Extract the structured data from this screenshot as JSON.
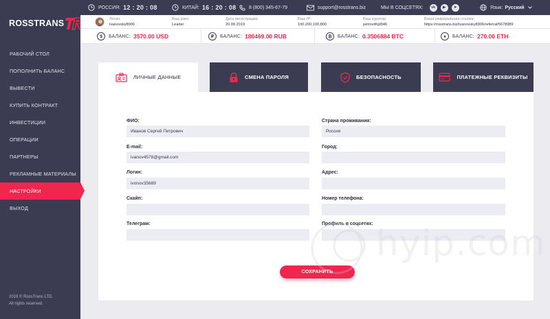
{
  "brand": {
    "logo_text": "ROSSTRANS"
  },
  "sidebar": {
    "items": [
      {
        "label": "РАБОЧИЙ СТОЛ"
      },
      {
        "label": "ПОПОЛНИТЬ БАЛАНС"
      },
      {
        "label": "ВЫВЕСТИ"
      },
      {
        "label": "КУПИТЬ КОНТРАКТ"
      },
      {
        "label": "ИНВЕСТИЦИИ"
      },
      {
        "label": "ОПЕРАЦИИ"
      },
      {
        "label": "ПАРТНЕРЫ"
      },
      {
        "label": "РЕКЛАМНЫЕ МАТЕРИАЛЫ"
      },
      {
        "label": "НАСТРОЙКИ",
        "active": true
      },
      {
        "label": "ВЫХОД"
      }
    ],
    "copyright_line1": "2019 © RossTrans LTD.",
    "copyright_line2": "All rights reserved."
  },
  "topbar": {
    "russia_label": "РОССИЯ:",
    "russia_time": "12 : 20 : 08",
    "china_label": "КИТАЙ:",
    "china_time": "16 : 20 : 08",
    "phone": "8 (800) 345-67-79",
    "email": "support@rosstrans.biz",
    "social_label": "МЫ В СОЦСЕТЯХ:",
    "language_label": "Язык:",
    "language_value": "Русский"
  },
  "userinfo": {
    "login_label": "Логин:",
    "login_value": "ivanovsky8906",
    "rank_label": "Ваш ранг:",
    "rank_value": "Leader",
    "reg_label": "Дата регистрации:",
    "reg_value": "20.09.2019",
    "ip_label": "Ваш IP:",
    "ip_value": "100.200.100.800",
    "curator_label": "Ваш куратор:",
    "curator_value": "petrovithjd346",
    "ref_label": "Ваша реферальная ссылка:",
    "ref_value": "https://rosstrans.biz/ivanovsky8906/referral/5678989"
  },
  "balances": [
    {
      "symbol": "$",
      "label": "БАЛАНС:",
      "value": "3570.00 USD"
    },
    {
      "symbol": "₽",
      "label": "БАЛАНС:",
      "value": "180469.00 RUB"
    },
    {
      "symbol": "₿",
      "label": "БАЛАНС:",
      "value": "0.3506884 BTC"
    },
    {
      "symbol": "♦",
      "label": "БАЛАНС:",
      "value": "270.00 ETH"
    }
  ],
  "tabs": [
    {
      "label": "ЛИЧНЫЕ ДАННЫЕ",
      "active": true
    },
    {
      "label": "СМЕНА ПАРОЛЯ"
    },
    {
      "label": "БЕЗОПАСНОСТЬ"
    },
    {
      "label": "ПЛАТЕЖНЫЕ РЕКВИЗИТЫ"
    }
  ],
  "form": {
    "fio_label": "ФИО:",
    "fio_value": "Иванов Сергей Петрович",
    "email_label": "E-mail:",
    "email_value": "ivanov4578@gmail.com",
    "login_label": "Логин:",
    "login_value": "ivonov35689",
    "skype_label": "Скайп:",
    "skype_value": "",
    "telegram_label": "Телеграм:",
    "telegram_value": "",
    "country_label": "Страна проживания:",
    "country_value": "Россия",
    "city_label": "Город:",
    "city_value": "",
    "address_label": "Адрес:",
    "address_value": "",
    "phone_label": "Номер телефона:",
    "phone_value": "",
    "social_label": "Профиль в соцсетях:",
    "social_value": "",
    "save_label": "СОХРАНИТЬ"
  },
  "watermark": {
    "text": "hyip.com"
  },
  "colors": {
    "accent": "#f0264f",
    "dark": "#3b3b52",
    "input_bg": "#ececf3",
    "page_bg": "#ebebf0"
  }
}
